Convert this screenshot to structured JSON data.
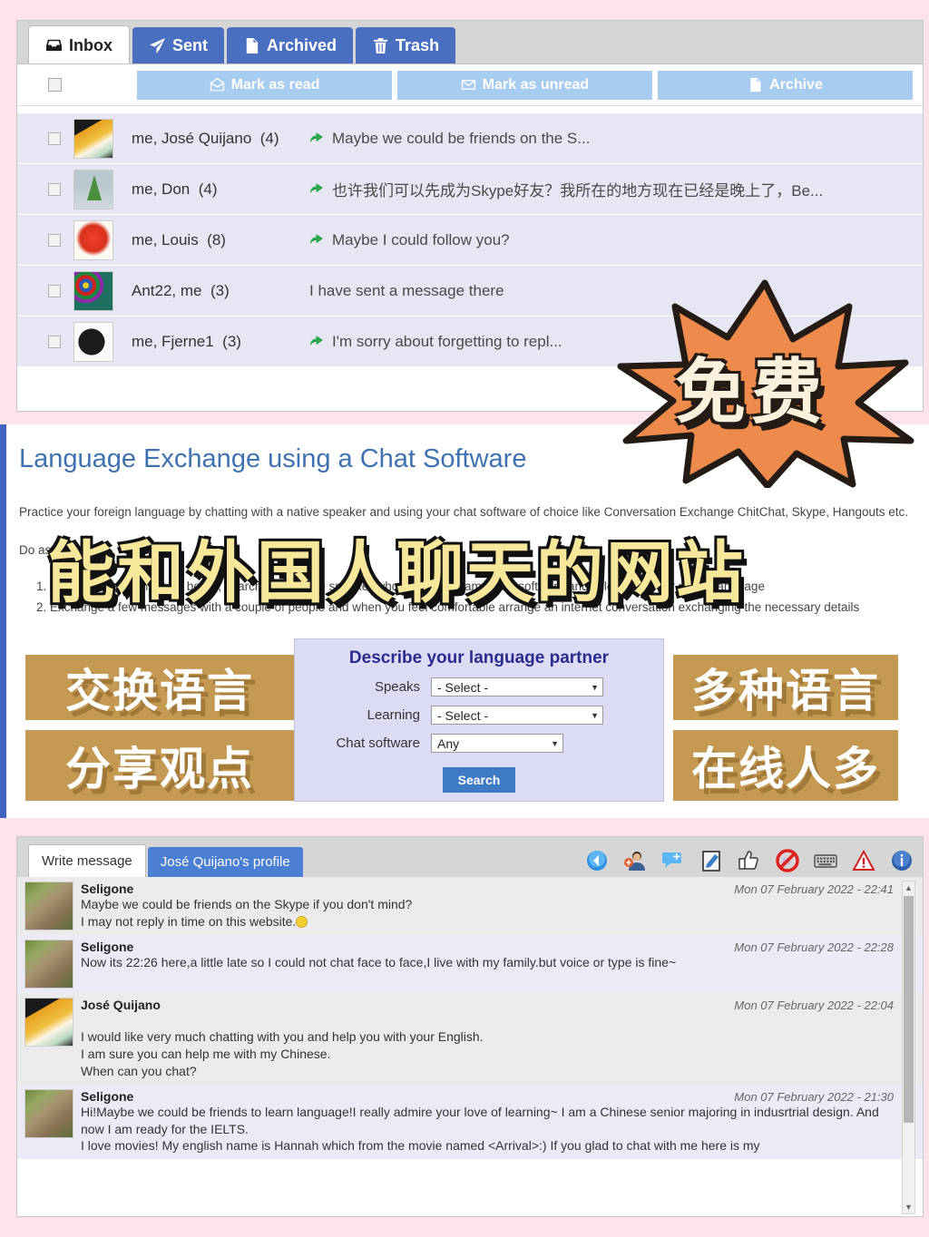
{
  "background": {
    "page_color": "#fbe3e9"
  },
  "inbox": {
    "tabs": [
      {
        "label": "Inbox",
        "icon": "inbox-icon",
        "active": true
      },
      {
        "label": "Sent",
        "icon": "paper-plane-icon",
        "active": false
      },
      {
        "label": "Archived",
        "icon": "file-archive-icon",
        "active": false
      },
      {
        "label": "Trash",
        "icon": "trash-icon",
        "active": false
      }
    ],
    "bulk_actions": [
      {
        "label": "Mark as read",
        "icon": "envelope-open-icon"
      },
      {
        "label": "Mark as unread",
        "icon": "envelope-closed-icon"
      },
      {
        "label": "Archive",
        "icon": "file-archive-icon"
      }
    ],
    "messages": [
      {
        "participants": "me, José Quijano",
        "count": "(4)",
        "preview": "Maybe we could be friends on the S...",
        "replied": true,
        "avatar": "toucan-avatar"
      },
      {
        "participants": "me, Don",
        "count": "(4)",
        "preview": "也许我们可以先成为Skype好友？我所在的地方现在已经是晚上了，Be...",
        "replied": true,
        "avatar": "sailboat-avatar"
      },
      {
        "participants": "me, Louis",
        "count": "(8)",
        "preview": "Maybe I could follow you?",
        "replied": true,
        "avatar": "berry-avatar"
      },
      {
        "participants": "Ant22, me",
        "count": "(3)",
        "preview": "I have sent a message there",
        "replied": false,
        "avatar": "billiards-avatar"
      },
      {
        "participants": "me, Fjerne1",
        "count": "(3)",
        "preview": "I'm sorry about forgetting to repl...",
        "replied": true,
        "avatar": "dumbbell-avatar"
      }
    ]
  },
  "language_exchange": {
    "title": "Language Exchange using a Chat Software",
    "intro": "Practice your foreign language by chatting with a native speaker and using your chat software of choice like Conversation Exchange ChitChat, Skype, Hangouts etc.",
    "do_as": "Do as follows:",
    "steps": [
      "Using the search feature below, search for a native speaker who uses your same chat software and is learning your native language",
      "Exchange a few messages with a couple of people and when you feel comfortable arrange an internet conversation exchanging the necessary details"
    ],
    "search_form": {
      "title": "Describe your language partner",
      "fields": [
        {
          "label": "Speaks",
          "value": "- Select -"
        },
        {
          "label": "Learning",
          "value": "- Select -"
        },
        {
          "label": "Chat software",
          "value": "Any"
        }
      ],
      "submit_label": "Search"
    }
  },
  "conversation": {
    "tabs": [
      {
        "label": "Write message",
        "active": true
      },
      {
        "label": "José Quijano's profile",
        "active": false
      }
    ],
    "toolbar_icons": [
      "back-arrow-icon",
      "add-friend-icon",
      "add-chat-icon",
      "edit-note-icon",
      "thumbs-up-icon",
      "block-user-icon",
      "keyboard-icon",
      "report-warning-icon",
      "info-icon"
    ],
    "messages": [
      {
        "author": "Seligone",
        "timestamp": "Mon 07 February 2022 - 22:41",
        "lines": [
          "Maybe we could be friends on the Skype if you don't mind?",
          "I may not reply in time on this website."
        ],
        "has_emoji": true,
        "avatar": "meerkat-avatar",
        "tone": "gray"
      },
      {
        "author": "Seligone",
        "timestamp": "Mon 07 February 2022 - 22:28",
        "lines": [
          "Now its 22:26 here,a little late so I could not chat face to face,I live with my family.but voice or type is fine~"
        ],
        "has_emoji": false,
        "avatar": "meerkat-avatar",
        "tone": "lilac"
      },
      {
        "author": "José Quijano",
        "timestamp": "Mon 07 February 2022 - 22:04",
        "lines": [
          "",
          "I would like very much chatting with you and help you with your English.",
          "I am sure you can help me with my Chinese.",
          "When can you chat?"
        ],
        "has_emoji": false,
        "avatar": "toucan-avatar",
        "tone": "gray"
      },
      {
        "author": "Seligone",
        "timestamp": "Mon 07 February 2022 - 21:30",
        "lines": [
          "Hi!Maybe we could be friends to learn language!I really admire your love of learning~ I am a Chinese senior majoring in indusrtrial design. And now I am ready for the IELTS.",
          "I love movies! My english name is Hannah which from the movie named <Arrival>:) If you glad to chat with me here is my"
        ],
        "has_emoji": false,
        "avatar": "meerkat-avatar",
        "tone": "lilac"
      }
    ]
  },
  "stickers": {
    "burst": {
      "text": "免费",
      "fill": "#faf0dc",
      "star_color": "#ef8a4d",
      "outline": "#241c14"
    },
    "headline": {
      "text": "能和外国人聊天的网站",
      "fill": "#f6e79a",
      "outline": "#111111"
    },
    "bands": [
      {
        "text": "交换语言",
        "bg": "#c49a52"
      },
      {
        "text": "分享观点",
        "bg": "#c49a52"
      },
      {
        "text": "多种语言",
        "bg": "#c49a52"
      },
      {
        "text": "在线人多",
        "bg": "#c49a52"
      }
    ]
  }
}
